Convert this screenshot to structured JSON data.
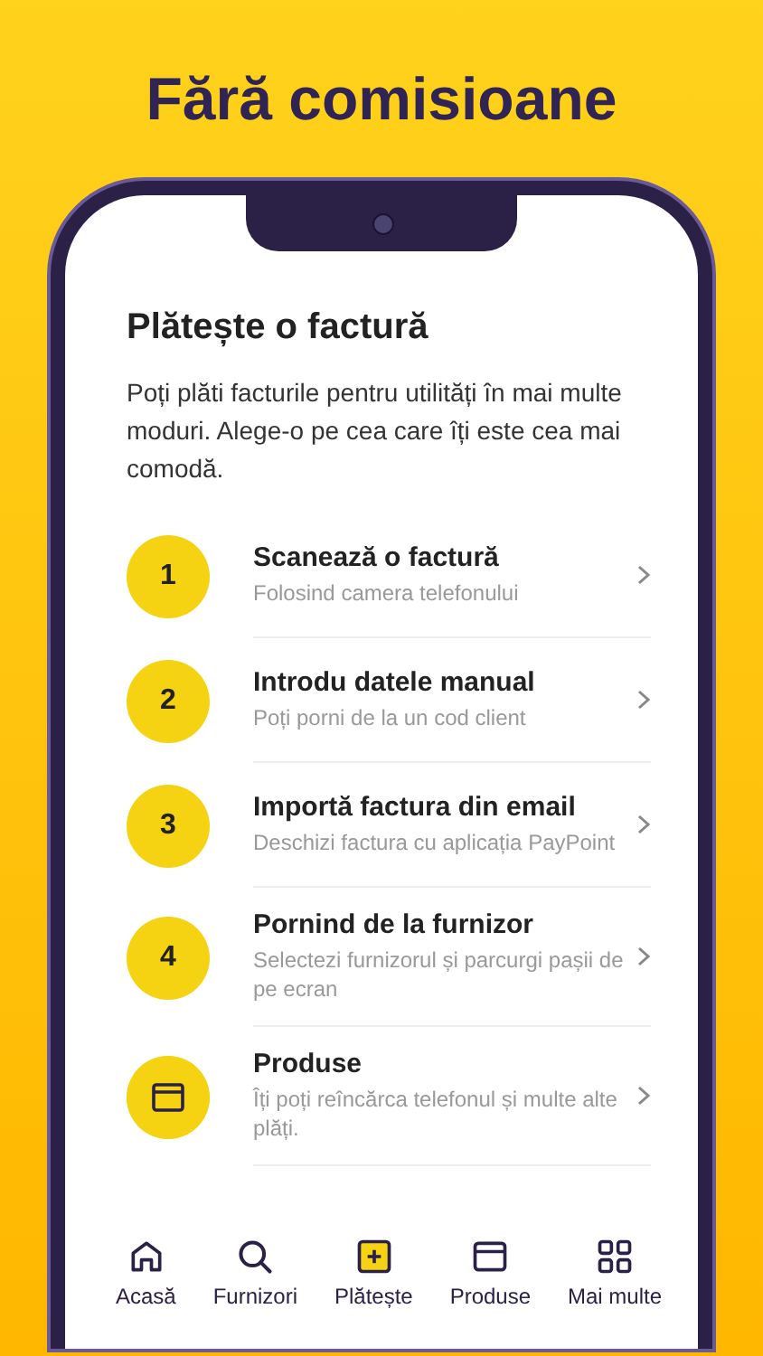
{
  "headline": "Fără comisioane",
  "screen": {
    "title": "Plătește o factură",
    "intro": "Poți plăti facturile pentru utilități în mai multe moduri. Alege-o pe cea care îți este cea mai comodă.",
    "options": [
      {
        "kind": "number",
        "badge": "1",
        "title": "Scanează o factură",
        "subtitle": "Folosind camera telefonului"
      },
      {
        "kind": "number",
        "badge": "2",
        "title": "Introdu datele manual",
        "subtitle": "Poți porni de la un cod client"
      },
      {
        "kind": "number",
        "badge": "3",
        "title": "Importă factura din email",
        "subtitle": "Deschizi factura cu aplicația PayPoint"
      },
      {
        "kind": "number",
        "badge": "4",
        "title": "Pornind de la furnizor",
        "subtitle": "Selectezi furnizorul și parcurgi pașii de pe ecran"
      },
      {
        "kind": "icon",
        "title": "Produse",
        "subtitle": "Îți poți reîncărca telefonul și multe alte plăți."
      }
    ],
    "nav": [
      {
        "label": "Acasă",
        "selected": false
      },
      {
        "label": "Furnizori",
        "selected": false
      },
      {
        "label": "Plătește",
        "selected": true
      },
      {
        "label": "Produse",
        "selected": false
      },
      {
        "label": "Mai multe",
        "selected": false
      }
    ]
  }
}
